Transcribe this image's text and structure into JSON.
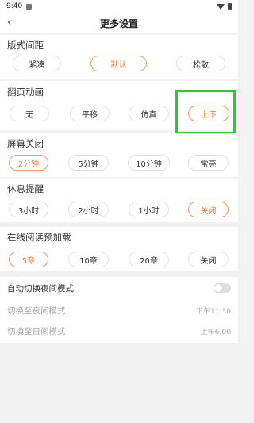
{
  "status_bar": {
    "time": "9:40"
  },
  "header": {
    "title": "更多设置"
  },
  "sections": [
    {
      "title": "版式间距",
      "options": [
        "紧凑",
        "默认",
        "松散"
      ],
      "selected": 1
    },
    {
      "title": "翻页动画",
      "options": [
        "无",
        "平移",
        "仿真",
        "上下"
      ],
      "selected": 3
    },
    {
      "title": "屏幕关闭",
      "options": [
        "2分钟",
        "5分钟",
        "10分钟",
        "常亮"
      ],
      "selected": 0
    },
    {
      "title": "休息提醒",
      "options": [
        "3小时",
        "2小时",
        "1小时",
        "关闭"
      ],
      "selected": 3
    },
    {
      "title": "在线阅读预加载",
      "options": [
        "5章",
        "10章",
        "20章",
        "关闭"
      ],
      "selected": 0
    }
  ],
  "night": {
    "auto_label": "自动切换夜间模式",
    "auto_enabled": false,
    "to_night_label": "切换至夜间模式",
    "to_night_time": "下午11:30",
    "to_day_label": "切换至日间模式",
    "to_day_time": "上午6:00"
  },
  "colors": {
    "accent": "#f07a3c",
    "accent_border": "#f19a6a",
    "highlight": "#34c534"
  }
}
